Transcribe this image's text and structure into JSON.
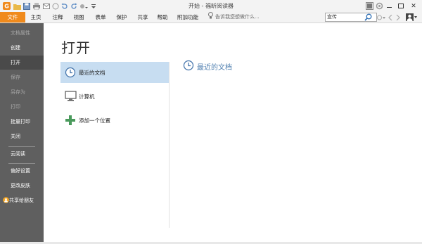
{
  "window": {
    "title": "开始 - 福昕阅读器"
  },
  "menu": {
    "items": [
      "文件",
      "主页",
      "注释",
      "视图",
      "表单",
      "保护",
      "共享",
      "帮助",
      "附加功能"
    ],
    "tell_me": "告诉我您想做什么...",
    "search_value": "宣传"
  },
  "sidebar": {
    "items": [
      {
        "label": "文档属性",
        "state": "disabled"
      },
      {
        "label": "创建",
        "state": "normal"
      },
      {
        "label": "打开",
        "state": "active"
      },
      {
        "label": "保存",
        "state": "disabled"
      },
      {
        "label": "另存为",
        "state": "disabled"
      },
      {
        "label": "打印",
        "state": "disabled"
      },
      {
        "label": "批量打印",
        "state": "normal"
      },
      {
        "label": "关闭",
        "state": "normal"
      },
      {
        "label": "云阅读",
        "state": "normal"
      },
      {
        "label": "偏好设置",
        "state": "normal"
      },
      {
        "label": "更改皮肤",
        "state": "normal"
      },
      {
        "label": "共享给朋友",
        "state": "normal"
      }
    ]
  },
  "main": {
    "heading": "打开",
    "options": [
      {
        "label": "最近的文档",
        "icon": "clock-icon",
        "selected": true
      },
      {
        "label": "计算机",
        "icon": "computer-icon",
        "selected": false
      },
      {
        "label": "添加一个位置",
        "icon": "add-location-icon",
        "selected": false
      }
    ],
    "panel_title": "最近的文档"
  },
  "colors": {
    "accent": "#f08a1c",
    "sidebar": "#5f5f5f",
    "selected": "#c7ddf1",
    "link": "#4f7fb0"
  }
}
